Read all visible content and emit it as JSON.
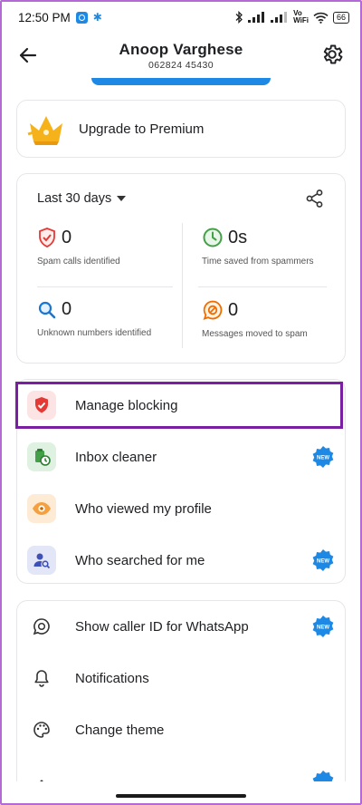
{
  "status_bar": {
    "time": "12:50 PM",
    "network_vo": "Vo",
    "network_wifi": "WiFi",
    "battery": "66",
    "icons": [
      "app-notification-icon",
      "settings-gear-icon",
      "bluetooth-icon",
      "signal-icon",
      "wifi-icon",
      "battery-icon"
    ]
  },
  "header": {
    "title": "Anoop Varghese",
    "subtitle": "062824 45430",
    "back_icon": "arrow-left-icon",
    "settings_icon": "gear-icon"
  },
  "premium": {
    "label": "Upgrade to Premium",
    "icon": "crown-icon"
  },
  "stats": {
    "period": "Last 30 days",
    "share_icon": "share-icon",
    "items": [
      {
        "value": "0",
        "label": "Spam calls identified",
        "icon": "shield-icon"
      },
      {
        "value": "0s",
        "label": "Time saved from spammers",
        "icon": "clock-icon"
      },
      {
        "value": "0",
        "label": "Unknown numbers identified",
        "icon": "search-icon"
      },
      {
        "value": "0",
        "label": "Messages moved to spam",
        "icon": "blocked-message-icon"
      }
    ]
  },
  "menu1": [
    {
      "label": "Manage blocking",
      "icon": "shield-block-icon",
      "new": false
    },
    {
      "label": "Inbox cleaner",
      "icon": "inbox-cleaner-icon",
      "new": true
    },
    {
      "label": "Who viewed my profile",
      "icon": "eye-icon",
      "new": false
    },
    {
      "label": "Who searched for me",
      "icon": "person-search-icon",
      "new": true
    }
  ],
  "menu2": [
    {
      "label": "Show caller ID for WhatsApp",
      "icon": "whatsapp-icon",
      "new": true
    },
    {
      "label": "Notifications",
      "icon": "bell-icon",
      "new": false
    },
    {
      "label": "Change theme",
      "icon": "palette-icon",
      "new": false
    }
  ],
  "badge_text": "NEW",
  "colors": {
    "accent_blue": "#1e88e5",
    "highlight_purple": "#7a1fa2",
    "spam_red": "#e53935",
    "time_green": "#43a047",
    "search_blue": "#1976d2",
    "message_orange": "#ef6c00"
  }
}
